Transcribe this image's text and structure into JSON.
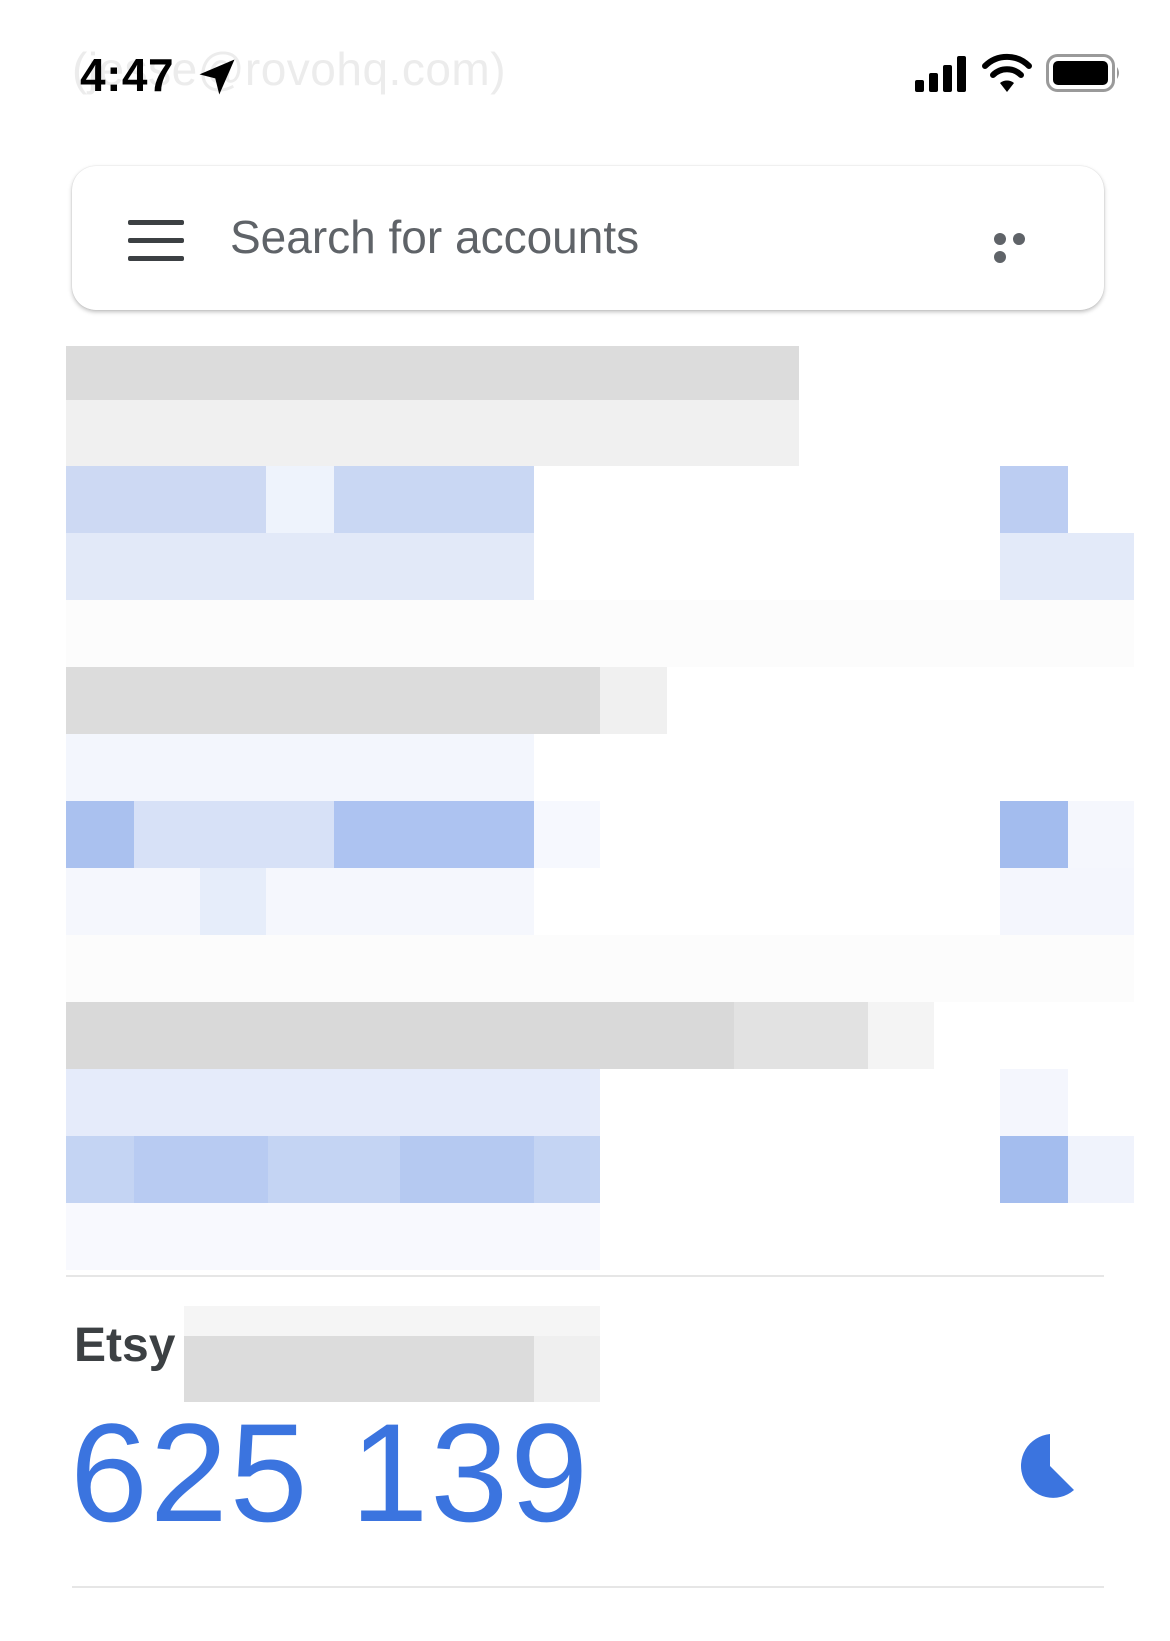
{
  "status_bar": {
    "time": "4:47",
    "icons": [
      "location-arrow-icon",
      "cellular-signal-icon",
      "wifi-icon",
      "battery-icon"
    ]
  },
  "background_ghost": {
    "account": "(jesse@rovohq.com)"
  },
  "search": {
    "placeholder": "Search for accounts",
    "menu_icon": "hamburger-menu-icon",
    "more_icon": "more-horizontal-icon"
  },
  "accounts": [
    {
      "issuer": "Etsy",
      "code": "625 139"
    }
  ],
  "colors": {
    "accent": "#3b74df",
    "text_secondary": "#5f6368",
    "text_primary": "#3c4043"
  },
  "icons": {
    "timer": "countdown-timer-icon"
  }
}
